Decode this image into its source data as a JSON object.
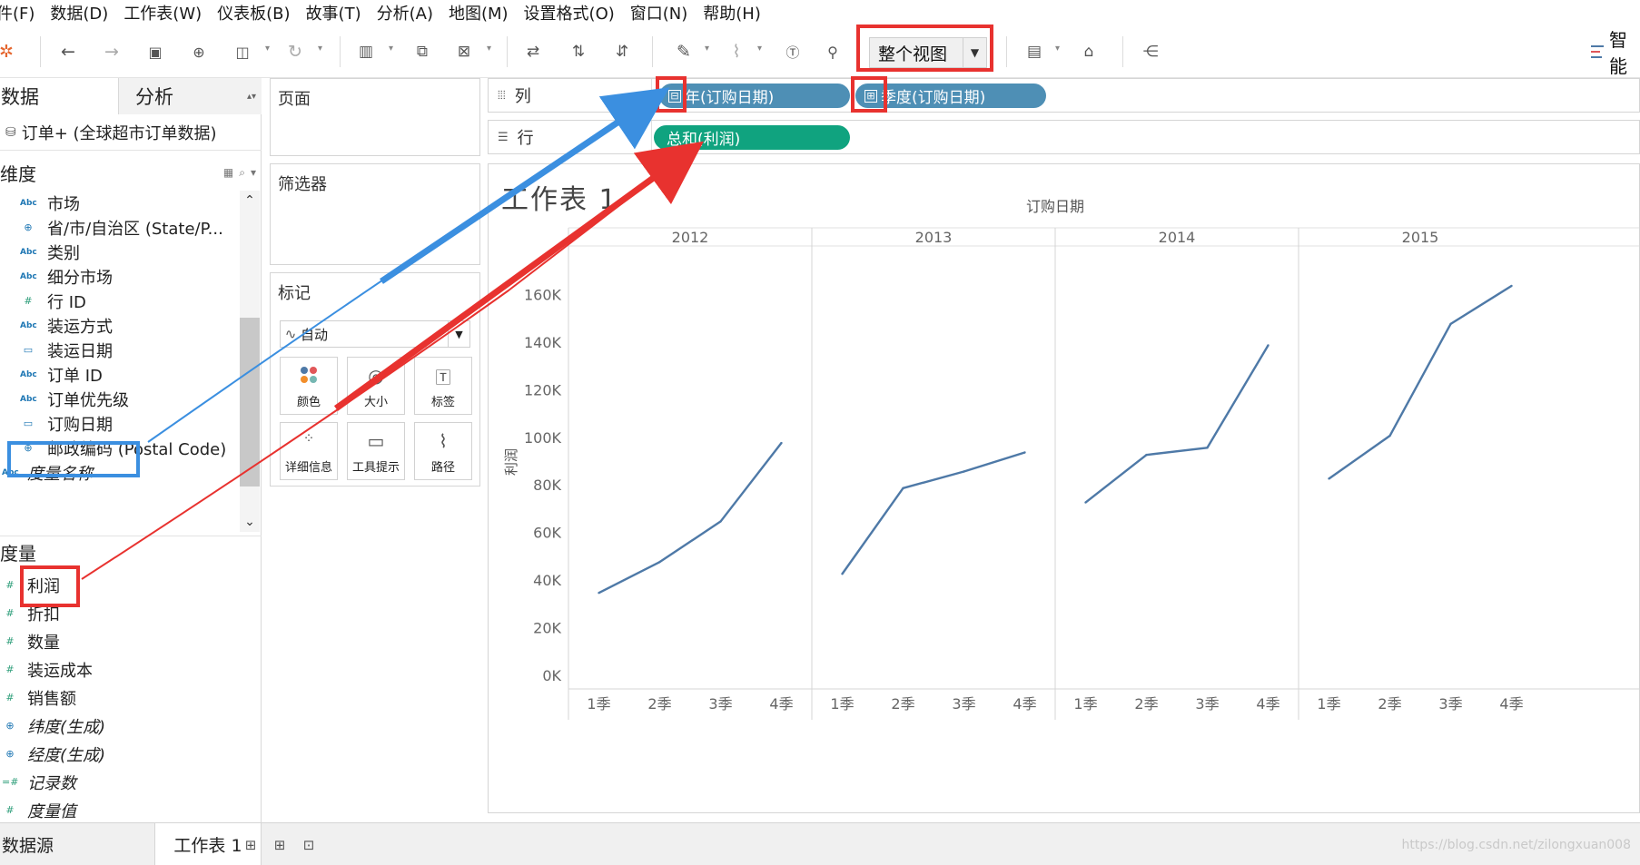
{
  "menu": [
    "件(F)",
    "数据(D)",
    "工作表(W)",
    "仪表板(B)",
    "故事(T)",
    "分析(A)",
    "地图(M)",
    "设置格式(O)",
    "窗口(N)",
    "帮助(H)"
  ],
  "toolbar": {
    "view_mode": "整个视图",
    "smart_label": "智能"
  },
  "left_panel": {
    "tabs": [
      "数据",
      "分析"
    ],
    "datasource": "订单+ (全球超市订单数据)",
    "dimensions_header": "维度",
    "dimensions": [
      {
        "icon": "Abc",
        "name": "市场"
      },
      {
        "icon": "⊕",
        "name": "省/市/自治区 (State/P..."
      },
      {
        "icon": "Abc",
        "name": "类别"
      },
      {
        "icon": "Abc",
        "name": "细分市场"
      },
      {
        "icon": "#",
        "name": "行 ID"
      },
      {
        "icon": "Abc",
        "name": "装运方式"
      },
      {
        "icon": "▭",
        "name": "装运日期"
      },
      {
        "icon": "Abc",
        "name": "订单 ID"
      },
      {
        "icon": "Abc",
        "name": "订单优先级"
      },
      {
        "icon": "▭",
        "name": "订购日期"
      },
      {
        "icon": "⊕",
        "name": "邮政编码 (Postal Code)"
      },
      {
        "icon": "Abc",
        "name": "度量名称"
      }
    ],
    "measures_header": "度量",
    "measures": [
      {
        "icon": "#",
        "name": "利润"
      },
      {
        "icon": "#",
        "name": "折扣"
      },
      {
        "icon": "#",
        "name": "数量"
      },
      {
        "icon": "#",
        "name": "装运成本"
      },
      {
        "icon": "#",
        "name": "销售额"
      },
      {
        "icon": "⊕",
        "name": "纬度(生成)"
      },
      {
        "icon": "⊕",
        "name": "经度(生成)"
      },
      {
        "icon": "=#",
        "name": "记录数"
      },
      {
        "icon": "#",
        "name": "度量值"
      }
    ]
  },
  "cards": {
    "pages": "页面",
    "filters": "筛选器",
    "marks": "标记",
    "marks_type": "自动",
    "mark_buttons": [
      "颜色",
      "大小",
      "标签",
      "详细信息",
      "工具提示",
      "路径"
    ]
  },
  "shelves": {
    "columns_label": "列",
    "rows_label": "行",
    "column_pills": [
      "年(订购日期)",
      "季度(订购日期)"
    ],
    "row_pills": [
      "总和(利润)"
    ]
  },
  "sheet": {
    "title": "工作表 1"
  },
  "chart_data": {
    "type": "line",
    "title": "",
    "xlabel": "订购日期",
    "ylabel": "利润",
    "ylim": [
      0,
      180000
    ],
    "yticks": [
      "0K",
      "20K",
      "40K",
      "60K",
      "80K",
      "100K",
      "120K",
      "140K",
      "160K"
    ],
    "ytick_values": [
      0,
      20000,
      40000,
      60000,
      80000,
      100000,
      120000,
      140000,
      160000
    ],
    "panels": [
      "2012",
      "2013",
      "2014",
      "2015"
    ],
    "categories": [
      "1季",
      "2季",
      "3季",
      "4季"
    ],
    "series": [
      {
        "panel": "2012",
        "values": [
          35000,
          48000,
          65000,
          98000
        ]
      },
      {
        "panel": "2013",
        "values": [
          43000,
          79000,
          86000,
          94000
        ]
      },
      {
        "panel": "2014",
        "values": [
          73000,
          93000,
          96000,
          139000
        ]
      },
      {
        "panel": "2015",
        "values": [
          83000,
          101000,
          148000,
          164000
        ]
      }
    ],
    "grid": false,
    "line_color": "#4e79a7"
  },
  "bottom": {
    "datasource_tab": "数据源",
    "sheet_tab": "工作表 1",
    "watermark": "https://blog.csdn.net/zilongxuan008"
  }
}
